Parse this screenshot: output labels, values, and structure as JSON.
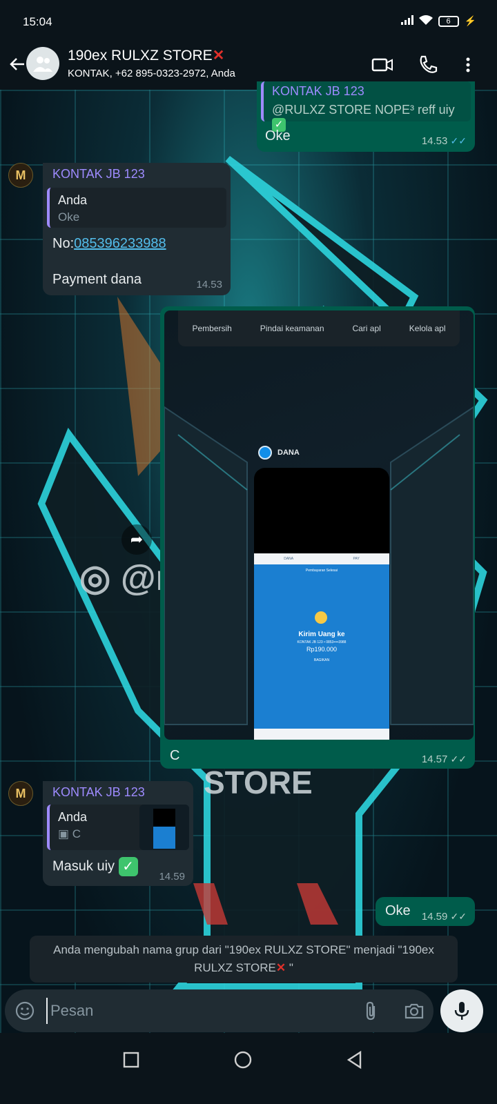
{
  "status_bar": {
    "time": "15:04",
    "battery": "6"
  },
  "header": {
    "title": "190ex RULXZ STORE",
    "title_emoji": "✕",
    "subtitle": "KONTAK, +62 895-0323-2972, Anda"
  },
  "messages": {
    "m1": {
      "quote_sender": "KONTAK JB 123",
      "quote_text": "@RULXZ STORE NOPE³ reff uiy",
      "text": "Oke",
      "time": "14.53"
    },
    "m2": {
      "sender": "KONTAK JB 123",
      "quote_sender": "Anda",
      "quote_text": "Oke",
      "number_prefix": "No:",
      "number_link": "085396233988",
      "text": "Payment dana",
      "time": "14.53"
    },
    "m3": {
      "image": {
        "tiles": [
          "Pembersih",
          "Pindai keamanan",
          "Cari apl",
          "Kelola apl"
        ],
        "app_label": "DANA",
        "app_bar_left": "DANA",
        "app_bar_right": "PAY",
        "app_subtitle": "Pembayaran Selesai",
        "send_title": "Kirim Uang ke",
        "send_to": "KONTAK JB 123 • 0853••••3988",
        "amount": "Rp190.000",
        "share": "BAGIKAN"
      },
      "caption": "C",
      "time": "14.57"
    },
    "m4": {
      "sender": "KONTAK JB 123",
      "quote_sender": "Anda",
      "quote_text": "C",
      "text": "Masuk uiy",
      "time": "14.59"
    },
    "m5": {
      "text": "Oke",
      "time": "14.59"
    }
  },
  "system_message": {
    "text": "Anda mengubah nama grup dari \"190ex RULXZ STORE\" menjadi \"190ex RULXZ STORE",
    "suffix": " \""
  },
  "composer": {
    "placeholder": "Pesan"
  },
  "colors": {
    "incoming": "#202c33",
    "outgoing": "#005c4b",
    "accent": "#53bdeb",
    "sender": "#9e8bff"
  }
}
